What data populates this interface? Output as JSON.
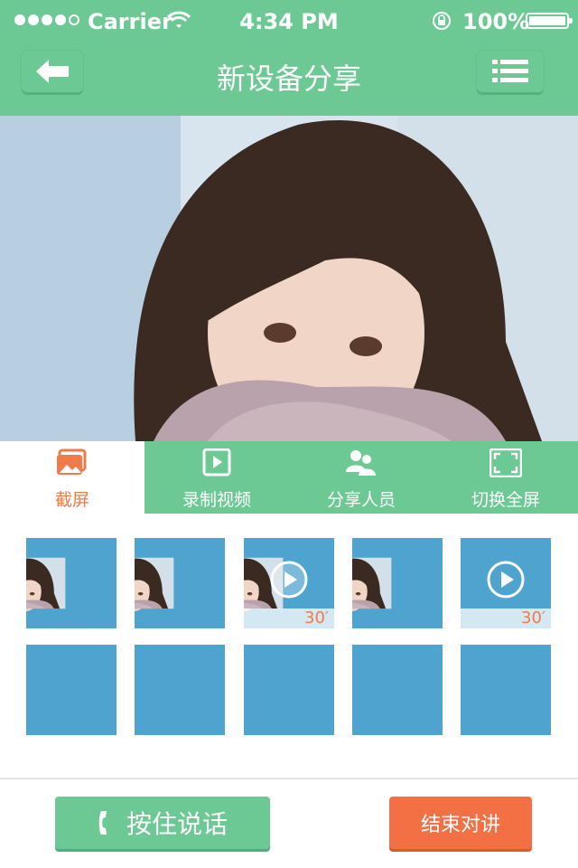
{
  "status_bar": {
    "carrier": "Carrier",
    "time": "4:34 PM",
    "battery_percent": "100%",
    "signal_bars_filled": 4,
    "signal_bars_total": 5
  },
  "nav": {
    "title": "新设备分享",
    "back_icon": "back-arrow-icon",
    "menu_icon": "list-menu-icon"
  },
  "tabs": [
    {
      "label": "截屏",
      "icon": "screenshot-icon",
      "active": true
    },
    {
      "label": "录制视频",
      "icon": "record-video-icon",
      "active": false
    },
    {
      "label": "分享人员",
      "icon": "share-people-icon",
      "active": false
    },
    {
      "label": "切换全屏",
      "icon": "fullscreen-icon",
      "active": false
    }
  ],
  "thumbnails": [
    {
      "type": "photo"
    },
    {
      "type": "photo"
    },
    {
      "type": "video",
      "duration": "30′"
    },
    {
      "type": "photo"
    },
    {
      "type": "video-placeholder",
      "duration": "30′"
    },
    {
      "type": "empty"
    },
    {
      "type": "empty"
    },
    {
      "type": "empty"
    },
    {
      "type": "empty"
    },
    {
      "type": "empty"
    }
  ],
  "actions": {
    "talk_label": "按住说话",
    "end_label": "结束对讲"
  },
  "colors": {
    "primary_green": "#6cc994",
    "accent_orange": "#f07a4a",
    "end_button": "#f37044",
    "placeholder_blue": "#4fa3cf"
  }
}
